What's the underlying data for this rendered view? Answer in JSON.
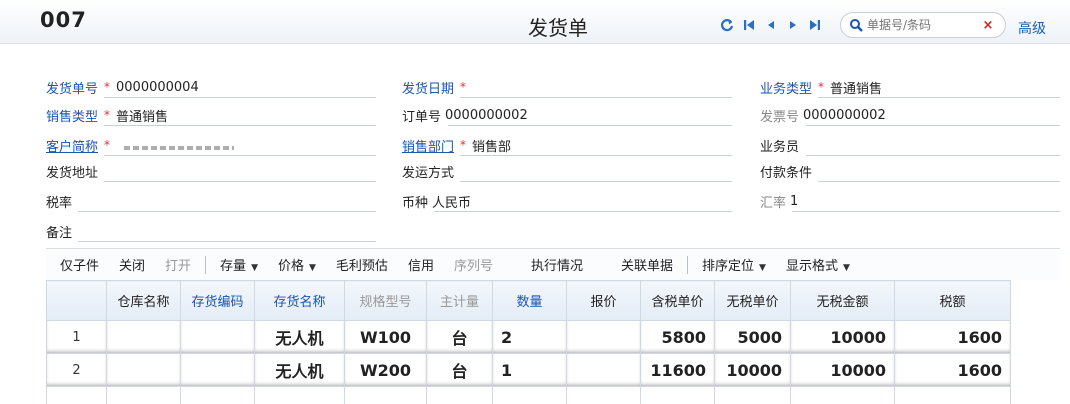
{
  "header": {
    "doc_code": "007",
    "title": "发货单",
    "search_placeholder": "单据号/条码",
    "advanced": "高级"
  },
  "form": {
    "delivery_no": {
      "label": "发货单号",
      "value": "0000000004"
    },
    "delivery_date": {
      "label": "发货日期",
      "value": ""
    },
    "biz_type": {
      "label": "业务类型",
      "value": "普通销售"
    },
    "sales_type": {
      "label": "销售类型",
      "value": "普通销售"
    },
    "order_no": {
      "label": "订单号",
      "value": "0000000002"
    },
    "invoice_no": {
      "label": "发票号",
      "value": "0000000002"
    },
    "customer": {
      "label": "客户简称",
      "value": ""
    },
    "sales_dept": {
      "label": "销售部门",
      "value": "销售部"
    },
    "salesperson": {
      "label": "业务员",
      "value": ""
    },
    "ship_address": {
      "label": "发货地址",
      "value": ""
    },
    "ship_method": {
      "label": "发运方式",
      "value": ""
    },
    "payment_terms": {
      "label": "付款条件",
      "value": ""
    },
    "tax_rate": {
      "label": "税率",
      "value": ""
    },
    "currency": {
      "label": "币种",
      "value": "人民币"
    },
    "exchange_rate": {
      "label": "汇率",
      "value": "1"
    },
    "remarks": {
      "label": "备注",
      "value": ""
    }
  },
  "toolbar": {
    "sub_items": "仅子件",
    "close": "关闭",
    "open": "打开",
    "stock": "存量",
    "price": "价格",
    "gross_profit": "毛利预估",
    "credit": "信用",
    "serial": "序列号",
    "execution": "执行情况",
    "related_docs": "关联单据",
    "sort_locate": "排序定位",
    "display_format": "显示格式"
  },
  "grid": {
    "headers": [
      "",
      "仓库名称",
      "存货编码",
      "存货名称",
      "规格型号",
      "主计量",
      "数量",
      "报价",
      "含税单价",
      "无税单价",
      "无税金额",
      "税额"
    ],
    "rows": [
      [
        "1",
        "",
        "",
        "无人机",
        "W100",
        "台",
        "2",
        "",
        "5800",
        "5000",
        "10000",
        "1600"
      ],
      [
        "2",
        "",
        "",
        "无人机",
        "W200",
        "台",
        "1",
        "",
        "11600",
        "10000",
        "10000",
        "1600"
      ]
    ]
  }
}
